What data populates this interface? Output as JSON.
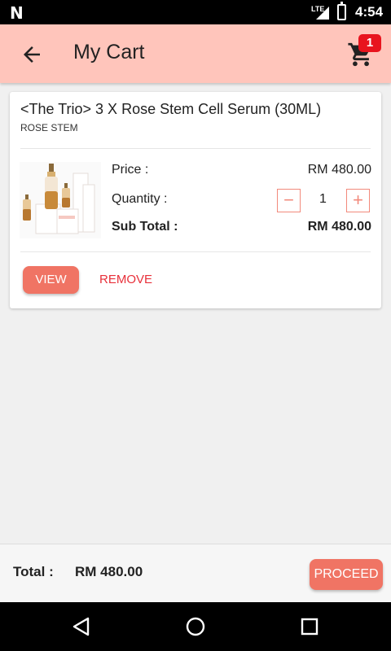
{
  "status_bar": {
    "network": "LTE",
    "time": "4:54"
  },
  "app_bar": {
    "title": "My Cart",
    "cart_count": "1"
  },
  "cart_item": {
    "title": "<The Trio> 3 X Rose Stem Cell Serum (30ML)",
    "brand": "ROSE STEM",
    "price_label": "Price :",
    "price_value": "RM 480.00",
    "quantity_label": "Quantity :",
    "quantity_value": "1",
    "decrease_symbol": "−",
    "increase_symbol": "+",
    "subtotal_label": "Sub Total :",
    "subtotal_value": "RM 480.00",
    "view_label": "VIEW",
    "remove_label": "REMOVE"
  },
  "footer": {
    "total_label": "Total :",
    "total_value": "RM 480.00",
    "proceed_label": "PROCEED"
  },
  "colors": {
    "app_bar_bg": "#ffc5bb",
    "accent": "#f07464",
    "badge": "#e8141e",
    "remove_text": "#e8303a"
  },
  "icons": {
    "status_left": "n-logo-icon",
    "signal": "signal-icon",
    "battery": "battery-charging-icon",
    "back": "arrow-back-icon",
    "cart": "shopping-cart-icon",
    "nav_back": "nav-back-icon",
    "nav_home": "nav-home-icon",
    "nav_recents": "nav-recents-icon"
  }
}
